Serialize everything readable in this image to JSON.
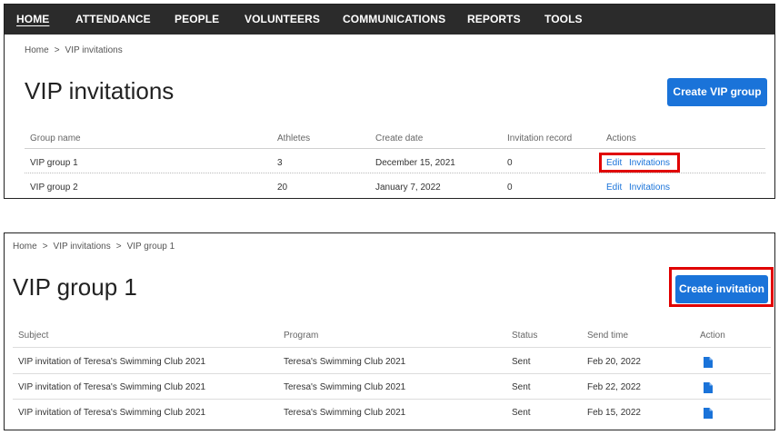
{
  "nav": {
    "items": [
      "HOME",
      "ATTENDANCE",
      "PEOPLE",
      "VOLUNTEERS",
      "COMMUNICATIONS",
      "REPORTS",
      "TOOLS"
    ],
    "active": "HOME"
  },
  "panel1": {
    "breadcrumb": [
      "Home",
      "VIP invitations"
    ],
    "breadcrumb_sep": ">",
    "title": "VIP invitations",
    "create_button": "Create VIP group",
    "columns": [
      "Group name",
      "Athletes",
      "Create date",
      "Invitation record",
      "Actions"
    ],
    "rows": [
      {
        "group_name": "VIP group 1",
        "athletes": "3",
        "create_date": "December 15, 2021",
        "invitation_record": "0",
        "edit": "Edit",
        "invitations": "Invitations"
      },
      {
        "group_name": "VIP group 2",
        "athletes": "20",
        "create_date": "January 7, 2022",
        "invitation_record": "0",
        "edit": "Edit",
        "invitations": "Invitations"
      }
    ]
  },
  "panel2": {
    "breadcrumb": [
      "Home",
      "VIP invitations",
      "VIP group 1"
    ],
    "breadcrumb_sep": ">",
    "title": "VIP group 1",
    "create_button": "Create invitation",
    "columns": [
      "Subject",
      "Program",
      "Status",
      "Send time",
      "Action"
    ],
    "rows": [
      {
        "subject": "VIP invitation of Teresa's Swimming Club 2021",
        "program": "Teresa's Swimming Club 2021",
        "status": "Sent",
        "send_time": "Feb 20, 2022",
        "action_icon": "document-icon"
      },
      {
        "subject": "VIP invitation of Teresa's Swimming Club 2021",
        "program": "Teresa's Swimming Club 2021",
        "status": "Sent",
        "send_time": "Feb 22, 2022",
        "action_icon": "document-icon"
      },
      {
        "subject": "VIP invitation of Teresa's Swimming Club 2021",
        "program": "Teresa's Swimming Club 2021",
        "status": "Sent",
        "send_time": "Feb 15, 2022",
        "action_icon": "document-icon"
      }
    ]
  },
  "colors": {
    "nav_bg": "#2b2b2b",
    "accent": "#1a73d9",
    "highlight": "#e00000"
  }
}
